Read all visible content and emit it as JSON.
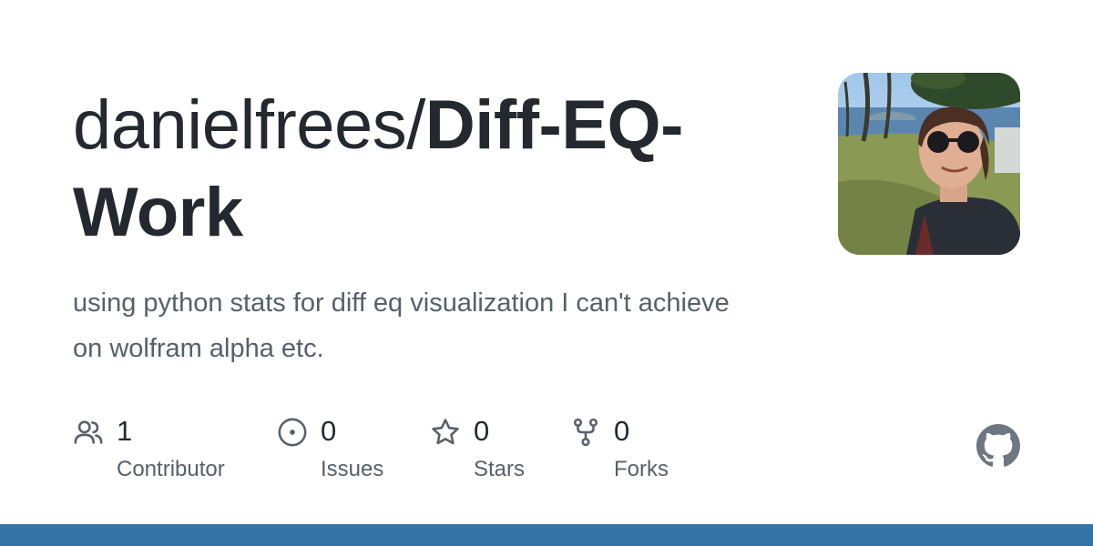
{
  "repo": {
    "owner_prefix": "danielfrees/",
    "name": "Diff-EQ-Work",
    "description": "using python stats for diff eq visualization I can't achieve on wolfram alpha etc."
  },
  "avatar": {
    "icon": "user-avatar-photo"
  },
  "stats": [
    {
      "count": "1",
      "label": "Contributor",
      "icon": "people-icon"
    },
    {
      "count": "0",
      "label": "Issues",
      "icon": "issue-circle-icon"
    },
    {
      "count": "0",
      "label": "Stars",
      "icon": "star-icon"
    },
    {
      "count": "0",
      "label": "Forks",
      "icon": "fork-icon"
    }
  ],
  "colors": {
    "title": "#24292f",
    "muted": "#57606a",
    "icon": "#57606a",
    "language_bar": "#3572a5",
    "github_logo": "#6e7681"
  },
  "logo": {
    "icon": "github-mark-icon"
  }
}
